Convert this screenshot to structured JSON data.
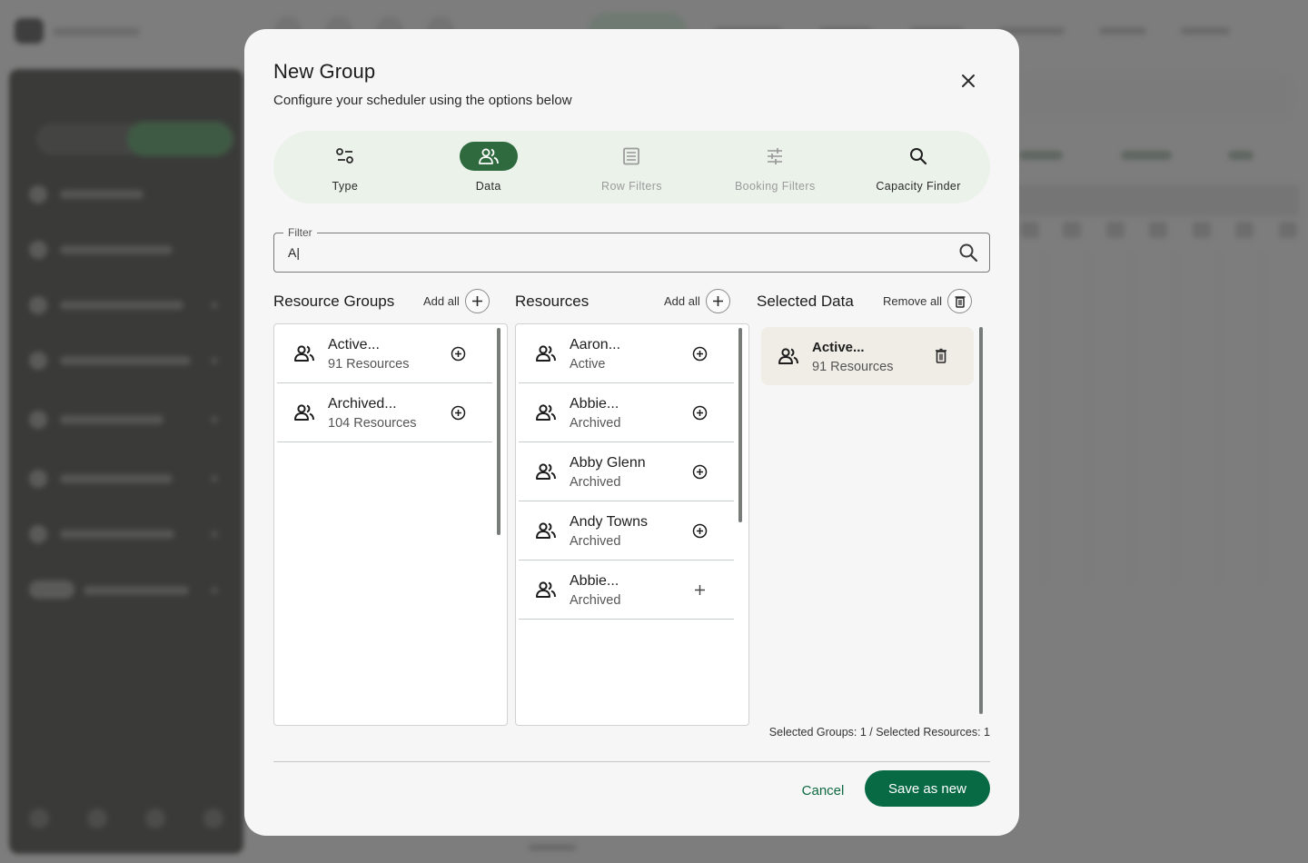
{
  "modal": {
    "title": "New Group",
    "subtitle": "Configure your scheduler using the options below",
    "close_icon": "close-icon"
  },
  "steps": [
    {
      "label": "Type",
      "icon": "type-toggle-icon",
      "state": "default"
    },
    {
      "label": "Data",
      "icon": "people-icon",
      "state": "active"
    },
    {
      "label": "Row Filters",
      "icon": "list-icon",
      "state": "disabled"
    },
    {
      "label": "Booking Filters",
      "icon": "tune-icon",
      "state": "disabled"
    },
    {
      "label": "Capacity Finder",
      "icon": "search-icon",
      "state": "default"
    }
  ],
  "filter": {
    "label": "Filter",
    "value": "A|",
    "search_icon": "search-icon"
  },
  "columns": {
    "resource_groups": {
      "title": "Resource Groups",
      "action_label": "Add all",
      "items": [
        {
          "title": "Active...",
          "subtitle": "91 Resources"
        },
        {
          "title": "Archived...",
          "subtitle": "104 Resources"
        }
      ]
    },
    "resources": {
      "title": "Resources",
      "action_label": "Add all",
      "items": [
        {
          "title": "Aaron...",
          "subtitle": "Active"
        },
        {
          "title": "Abbie...",
          "subtitle": "Archived"
        },
        {
          "title": "Abby Glenn",
          "subtitle": "Archived"
        },
        {
          "title": "Andy Towns",
          "subtitle": "Archived"
        },
        {
          "title": "Abbie...",
          "subtitle": "Archived"
        }
      ]
    },
    "selected": {
      "title": "Selected Data",
      "action_label": "Remove all",
      "items": [
        {
          "title": "Active...",
          "subtitle": "91 Resources"
        }
      ]
    }
  },
  "summary": "Selected Groups: 1 / Selected Resources: 1",
  "footer": {
    "cancel_label": "Cancel",
    "save_label": "Save as new"
  },
  "colors": {
    "accent": "#076a45",
    "active_step": "#2f6a3f",
    "steps_bg": "#eaf2ea",
    "selected_card": "#efede6"
  }
}
